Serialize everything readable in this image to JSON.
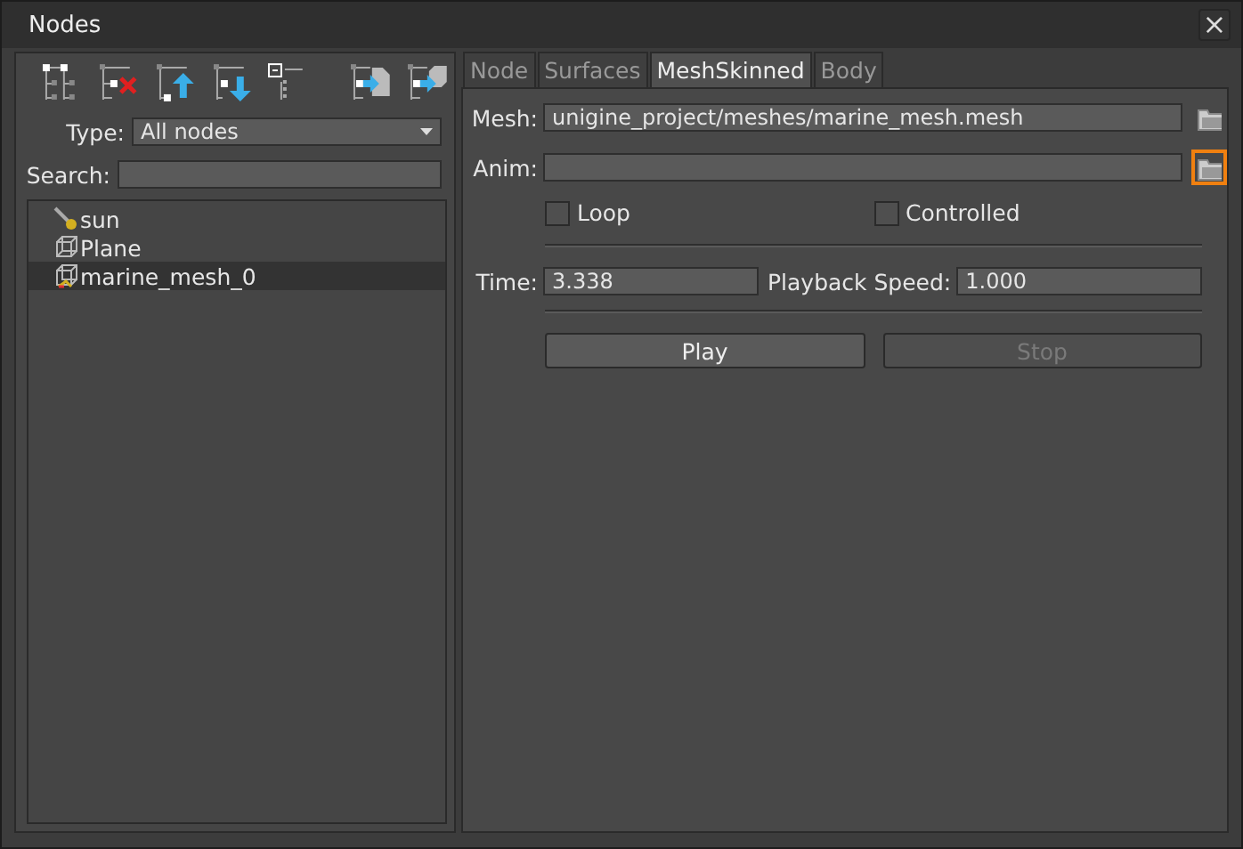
{
  "window": {
    "title": "Nodes",
    "close": "×"
  },
  "toolbar": [
    {
      "kind": "tree"
    },
    {
      "kind": "delete"
    },
    {
      "kind": "up"
    },
    {
      "kind": "down"
    },
    {
      "kind": "collapse"
    },
    {
      "kind": "export-file"
    },
    {
      "kind": "export-box"
    }
  ],
  "type_filter": {
    "label": "Type:",
    "value": "All nodes"
  },
  "search": {
    "label": "Search:"
  },
  "tree": [
    {
      "label": "sun",
      "kind": "light",
      "selected": false
    },
    {
      "label": "Plane",
      "kind": "mesh",
      "selected": false
    },
    {
      "label": "marine_mesh_0",
      "kind": "skinned",
      "selected": true
    }
  ],
  "tabs": [
    {
      "label": "Node",
      "selected": false
    },
    {
      "label": "Surfaces",
      "selected": false
    },
    {
      "label": "MeshSkinned",
      "selected": true
    },
    {
      "label": "Body",
      "selected": false
    }
  ],
  "mesh": {
    "label": "Mesh:",
    "value": "unigine_project/meshes/marine_mesh.mesh",
    "browse_focused": false
  },
  "anim": {
    "label": "Anim:",
    "browse_focused": true
  },
  "checkboxes": [
    {
      "label": "Loop",
      "checked": false
    },
    {
      "label": "Controlled",
      "checked": false
    }
  ],
  "time": {
    "label": "Time:",
    "value": "3.338"
  },
  "playback_speed": {
    "label": "Playback Speed:",
    "value": "1.000"
  },
  "buttons": [
    {
      "label": "Play",
      "disabled": false
    },
    {
      "label": "Stop",
      "disabled": true
    }
  ]
}
